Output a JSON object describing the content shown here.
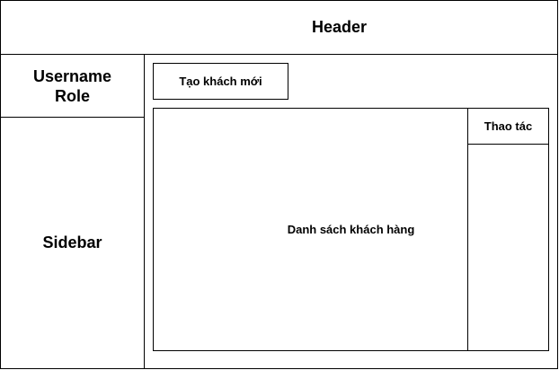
{
  "header": {
    "title": "Header"
  },
  "user_panel": {
    "text": "Username\nRole"
  },
  "sidebar": {
    "label": "Sidebar"
  },
  "main": {
    "create_button_label": "Tạo khách mới",
    "list_label": "Danh sách khách hàng",
    "actions_label": "Thao tác"
  }
}
